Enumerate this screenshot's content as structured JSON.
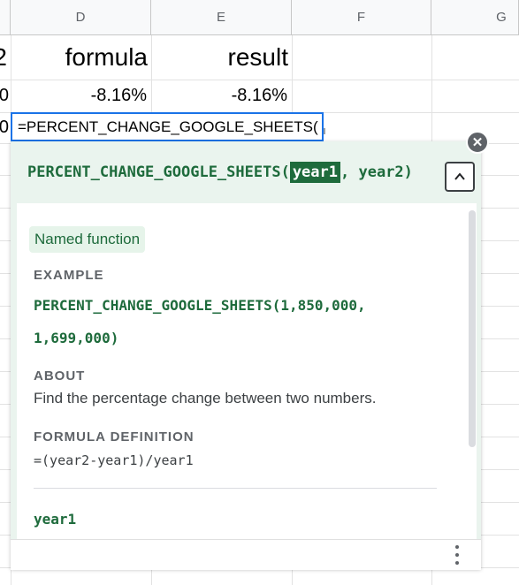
{
  "columns": [
    "D",
    "E",
    "F",
    "G"
  ],
  "row_header_fragments": {
    "row1": "2",
    "row2": "0",
    "row3": "0"
  },
  "cells": {
    "d1": "formula",
    "e1": "result",
    "d2": "-8.16%",
    "e2": "-8.16%"
  },
  "editor": {
    "value": "=PERCENT_CHANGE_GOOGLE_SHEETS("
  },
  "popup": {
    "header": {
      "function_name": "PERCENT_CHANGE_GOOGLE_SHEETS(",
      "active_arg": "year1",
      "separator": ", ",
      "other_arg": "year2",
      "close_paren": ")"
    },
    "chip": "Named function",
    "example_label": "EXAMPLE",
    "example_line1": "PERCENT_CHANGE_GOOGLE_SHEETS(1,850,000,",
    "example_line2": "1,699,000)",
    "about_label": "ABOUT",
    "about_text": "Find the percentage change between two numbers.",
    "definition_label": "FORMULA DEFINITION",
    "definition_text": "=(year2-year1)/year1",
    "arg_heading": "year1"
  },
  "icons": {
    "close": "close-icon",
    "collapse": "chevron-up-icon",
    "more": "more-vert-icon"
  },
  "colors": {
    "accent_green": "#1e6b3c",
    "popup_bg": "#eaf4ee",
    "selection_blue": "#1a73e8"
  }
}
